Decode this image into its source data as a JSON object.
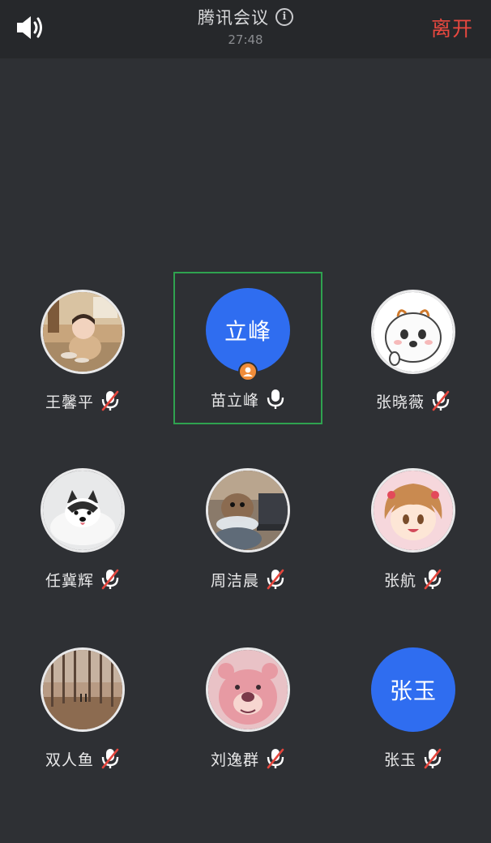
{
  "header": {
    "title": "腾讯会议",
    "timer": "27:48",
    "leave_label": "离开",
    "speaker_icon": "speaker-icon",
    "info_icon": "info-icon"
  },
  "colors": {
    "background": "#2e3034",
    "topbar": "#26282b",
    "accent_blue": "#2f6df0",
    "leave_red": "#e9483f",
    "active_border": "#2fa24f",
    "mute_slash": "#e4463d",
    "host_badge": "#f08c3a"
  },
  "participants": [
    {
      "name": "王馨平",
      "mic": "muted",
      "avatar": "photo-child"
    },
    {
      "name": "苗立峰",
      "mic": "on",
      "avatar_text": "立峰",
      "active": true,
      "host": true
    },
    {
      "name": "张晓薇",
      "mic": "muted",
      "avatar": "cartoon-bun"
    },
    {
      "name": "任冀辉",
      "mic": "muted",
      "avatar": "photo-husky"
    },
    {
      "name": "周洁晨",
      "mic": "muted",
      "avatar": "photo-dog-laptop"
    },
    {
      "name": "张航",
      "mic": "muted",
      "avatar": "cartoon-girl"
    },
    {
      "name": "双人鱼",
      "mic": "muted",
      "avatar": "photo-forest"
    },
    {
      "name": "刘逸群",
      "mic": "muted",
      "avatar": "cartoon-pink-bear"
    },
    {
      "name": "张玉",
      "mic": "muted",
      "avatar_text": "张玉"
    }
  ]
}
